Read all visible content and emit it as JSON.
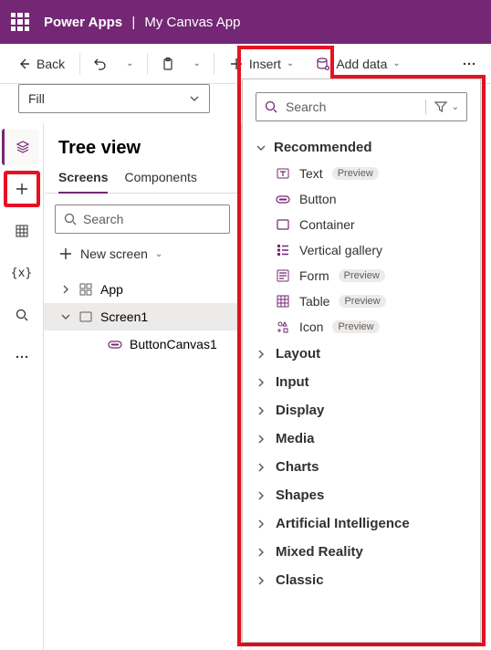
{
  "header": {
    "product": "Power Apps",
    "app": "My Canvas App"
  },
  "cmdbar": {
    "back": "Back",
    "insert": "Insert",
    "add_data": "Add data"
  },
  "fill": {
    "label": "Fill"
  },
  "leftrail": {},
  "tree": {
    "title": "Tree view",
    "tabs": {
      "screens": "Screens",
      "components": "Components"
    },
    "search_placeholder": "Search",
    "new_screen": "New screen",
    "app": "App",
    "screen": "Screen1",
    "control": "ButtonCanvas1"
  },
  "flyout": {
    "search_placeholder": "Search",
    "recommended": "Recommended",
    "preview": "Preview",
    "items": {
      "text": "Text",
      "button": "Button",
      "container": "Container",
      "vgallery": "Vertical gallery",
      "form": "Form",
      "table": "Table",
      "icon": "Icon"
    },
    "categories": [
      "Layout",
      "Input",
      "Display",
      "Media",
      "Charts",
      "Shapes",
      "Artificial Intelligence",
      "Mixed Reality",
      "Classic"
    ]
  }
}
